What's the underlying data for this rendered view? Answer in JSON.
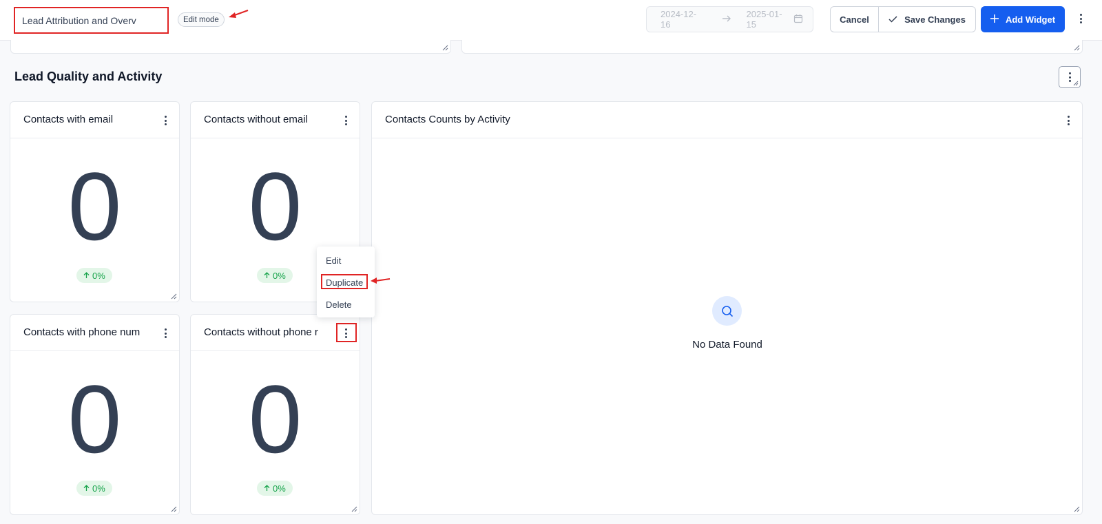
{
  "header": {
    "title_value": "Lead Attribution and Overv",
    "edit_badge": "Edit mode",
    "date_start": "2024-12-16",
    "date_end": "2025-01-15",
    "cancel_label": "Cancel",
    "save_label": "Save Changes",
    "add_widget_label": "Add Widget"
  },
  "section": {
    "title": "Lead Quality and Activity"
  },
  "cards": [
    {
      "title": "Contacts with email",
      "value": "0",
      "delta": "0%"
    },
    {
      "title": "Contacts without email",
      "value": "0",
      "delta": "0%"
    },
    {
      "title": "Contacts with phone num",
      "value": "0",
      "delta": "0%"
    },
    {
      "title": "Contacts without phone r",
      "value": "0",
      "delta": "0%"
    }
  ],
  "activity_card": {
    "title": "Contacts Counts by Activity",
    "empty_text": "No Data Found"
  },
  "context_menu": {
    "items": [
      "Edit",
      "Duplicate",
      "Delete"
    ]
  },
  "colors": {
    "primary": "#155eef",
    "highlight": "#e02424",
    "positive": "#16a34a"
  },
  "icons": [
    "arrow-right-icon",
    "calendar-icon",
    "check-icon",
    "plus-icon",
    "kebab-icon",
    "resize-handle-icon",
    "search-icon",
    "arrow-up-icon"
  ]
}
